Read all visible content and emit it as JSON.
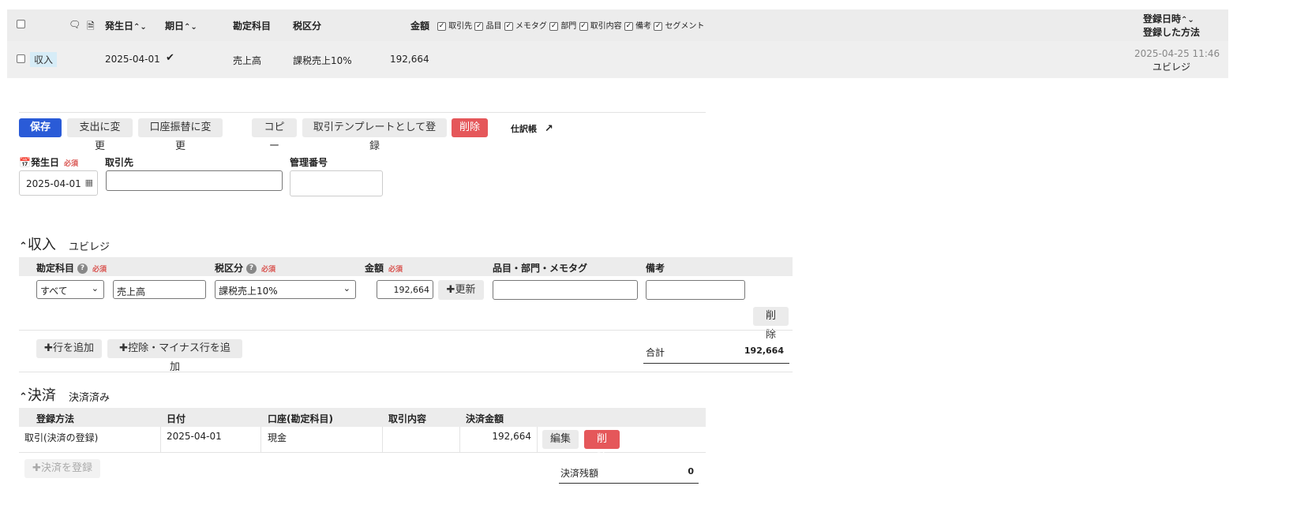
{
  "list_header": {
    "date": "発生日",
    "due": "期日",
    "account": "勘定科目",
    "tax": "税区分",
    "amount": "金額",
    "toggles": [
      "取引先",
      "品目",
      "メモタグ",
      "部門",
      "取引内容",
      "備考",
      "セグメント"
    ],
    "registered_at": "登録日時",
    "method": "登録した方法"
  },
  "list_row": {
    "type": "収入",
    "date": "2025-04-01",
    "account": "売上高",
    "tax": "課税売上10%",
    "amount": "192,664",
    "registered_at": "2025-04-25 11:46",
    "method": "ユビレジ"
  },
  "toolbar": {
    "save": "保存",
    "to_expense": "支出に変更",
    "to_transfer": "口座振替に変更",
    "copy": "コピー",
    "template": "取引テンプレートとして登録",
    "delete": "削除",
    "journal": "仕訳帳"
  },
  "form": {
    "date_label": "発生日",
    "required": "必須",
    "date_value": "2025-04-01",
    "partner_label": "取引先",
    "partner_value": "",
    "ref_label": "管理番号",
    "ref_value": ""
  },
  "income": {
    "title": "収入",
    "subtitle": "ユビレジ",
    "headers": {
      "account": "勘定科目",
      "tax": "税区分",
      "amount": "金額",
      "tags": "品目・部門・メモタグ",
      "memo": "備考"
    },
    "row": {
      "filter": "すべて",
      "account": "売上高",
      "tax": "課税売上10%",
      "amount": "192,664",
      "update": "更新",
      "delete": "削除"
    },
    "add_row": "行を追加",
    "add_deduction": "控除・マイナス行を追加",
    "total_label": "合計",
    "total_value": "192,664"
  },
  "settlement": {
    "title": "決済",
    "subtitle": "決済済み",
    "headers": {
      "method": "登録方法",
      "date": "日付",
      "account": "口座(勘定科目)",
      "content": "取引内容",
      "amount": "決済金額"
    },
    "row": {
      "method": "取引(決済の登録)",
      "date": "2025-04-01",
      "account": "現金",
      "content": "",
      "amount": "192,664",
      "edit": "編集",
      "delete": "削除"
    },
    "register": "決済を登録",
    "balance_label": "決済残額",
    "balance_value": "0"
  }
}
